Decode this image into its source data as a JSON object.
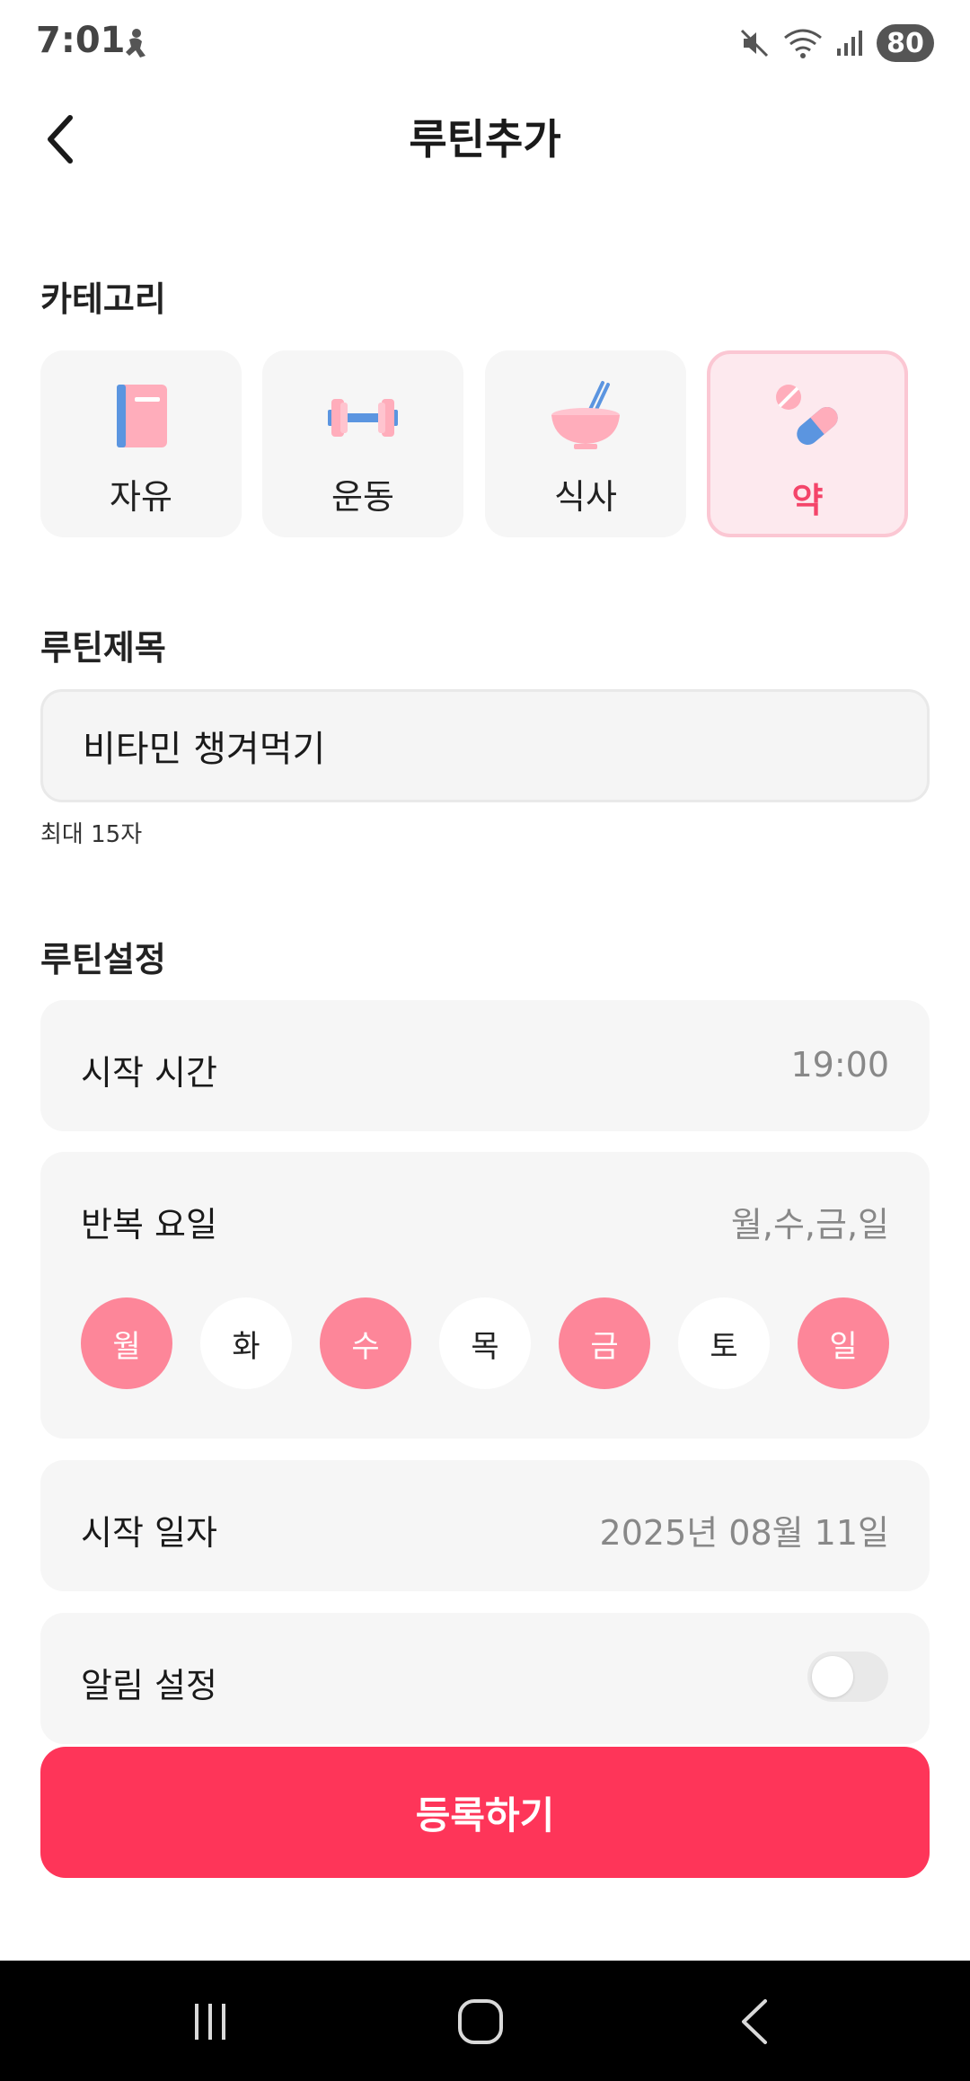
{
  "status_bar": {
    "time": "7:01",
    "battery": "80"
  },
  "header": {
    "title": "루틴추가"
  },
  "category": {
    "label": "카테고리",
    "items": [
      {
        "label": "자유",
        "icon": "notebook-icon"
      },
      {
        "label": "운동",
        "icon": "dumbbell-icon"
      },
      {
        "label": "식사",
        "icon": "bowl-chopsticks-icon"
      },
      {
        "label": "약",
        "icon": "pill-icon",
        "selected": true
      }
    ]
  },
  "routine_title": {
    "label": "루틴제목",
    "value": "비타민 챙겨먹기",
    "hint": "최대 15자"
  },
  "routine_settings": {
    "label": "루틴설정",
    "start_time": {
      "label": "시작 시간",
      "value": "19:00"
    },
    "repeat_days": {
      "label": "반복 요일",
      "value": "월,수,금,일",
      "days": [
        {
          "label": "월",
          "selected": true
        },
        {
          "label": "화",
          "selected": false
        },
        {
          "label": "수",
          "selected": true
        },
        {
          "label": "목",
          "selected": false
        },
        {
          "label": "금",
          "selected": true
        },
        {
          "label": "토",
          "selected": false
        },
        {
          "label": "일",
          "selected": true
        }
      ]
    },
    "start_date": {
      "label": "시작 일자",
      "value": "2025년 08월 11일"
    },
    "notification": {
      "label": "알림 설정",
      "enabled": false
    }
  },
  "submit": {
    "label": "등록하기"
  },
  "colors": {
    "accent": "#fe3559",
    "day_selected": "#fd8699",
    "selected_card_bg": "#fde9ee"
  }
}
